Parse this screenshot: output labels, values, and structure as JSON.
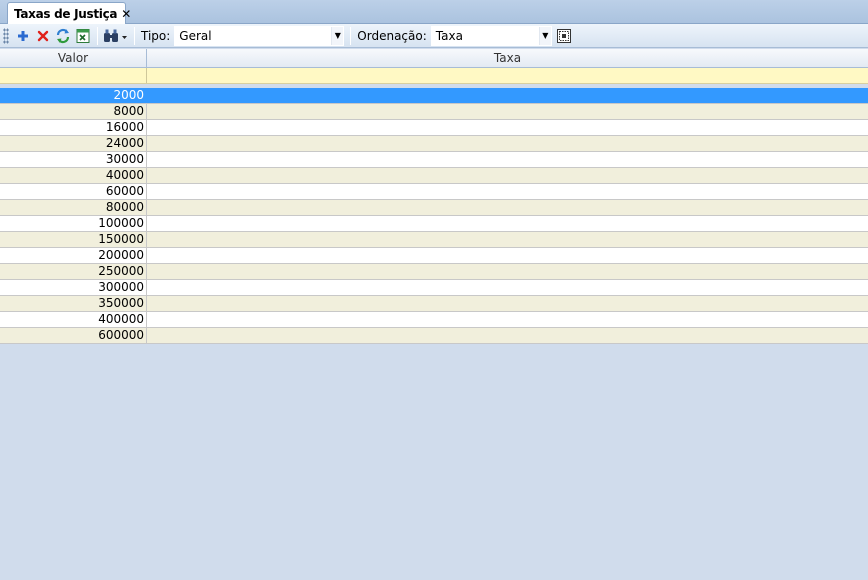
{
  "tab": {
    "title": "Taxas de Justiça",
    "close_glyph": "✕"
  },
  "toolbar": {
    "tipo_label": "Tipo:",
    "tipo_value": "Geral",
    "ordenacao_label": "Ordenação:",
    "ordenacao_value": "Taxa",
    "dropdown_glyph": "▼"
  },
  "grid": {
    "columns": [
      "Valor",
      "Taxa"
    ],
    "selected_index": 0,
    "rows": [
      {
        "valor": "2000",
        "taxa": ""
      },
      {
        "valor": "8000",
        "taxa": ""
      },
      {
        "valor": "16000",
        "taxa": ""
      },
      {
        "valor": "24000",
        "taxa": ""
      },
      {
        "valor": "30000",
        "taxa": ""
      },
      {
        "valor": "40000",
        "taxa": ""
      },
      {
        "valor": "60000",
        "taxa": ""
      },
      {
        "valor": "80000",
        "taxa": ""
      },
      {
        "valor": "100000",
        "taxa": ""
      },
      {
        "valor": "150000",
        "taxa": ""
      },
      {
        "valor": "200000",
        "taxa": ""
      },
      {
        "valor": "250000",
        "taxa": ""
      },
      {
        "valor": "300000",
        "taxa": ""
      },
      {
        "valor": "350000",
        "taxa": ""
      },
      {
        "valor": "400000",
        "taxa": ""
      },
      {
        "valor": "600000",
        "taxa": ""
      }
    ]
  },
  "colors": {
    "selection": "#3399ff",
    "filter_row": "#fff9c4",
    "alt_row": "#f1efdc",
    "background": "#d0dcec"
  }
}
